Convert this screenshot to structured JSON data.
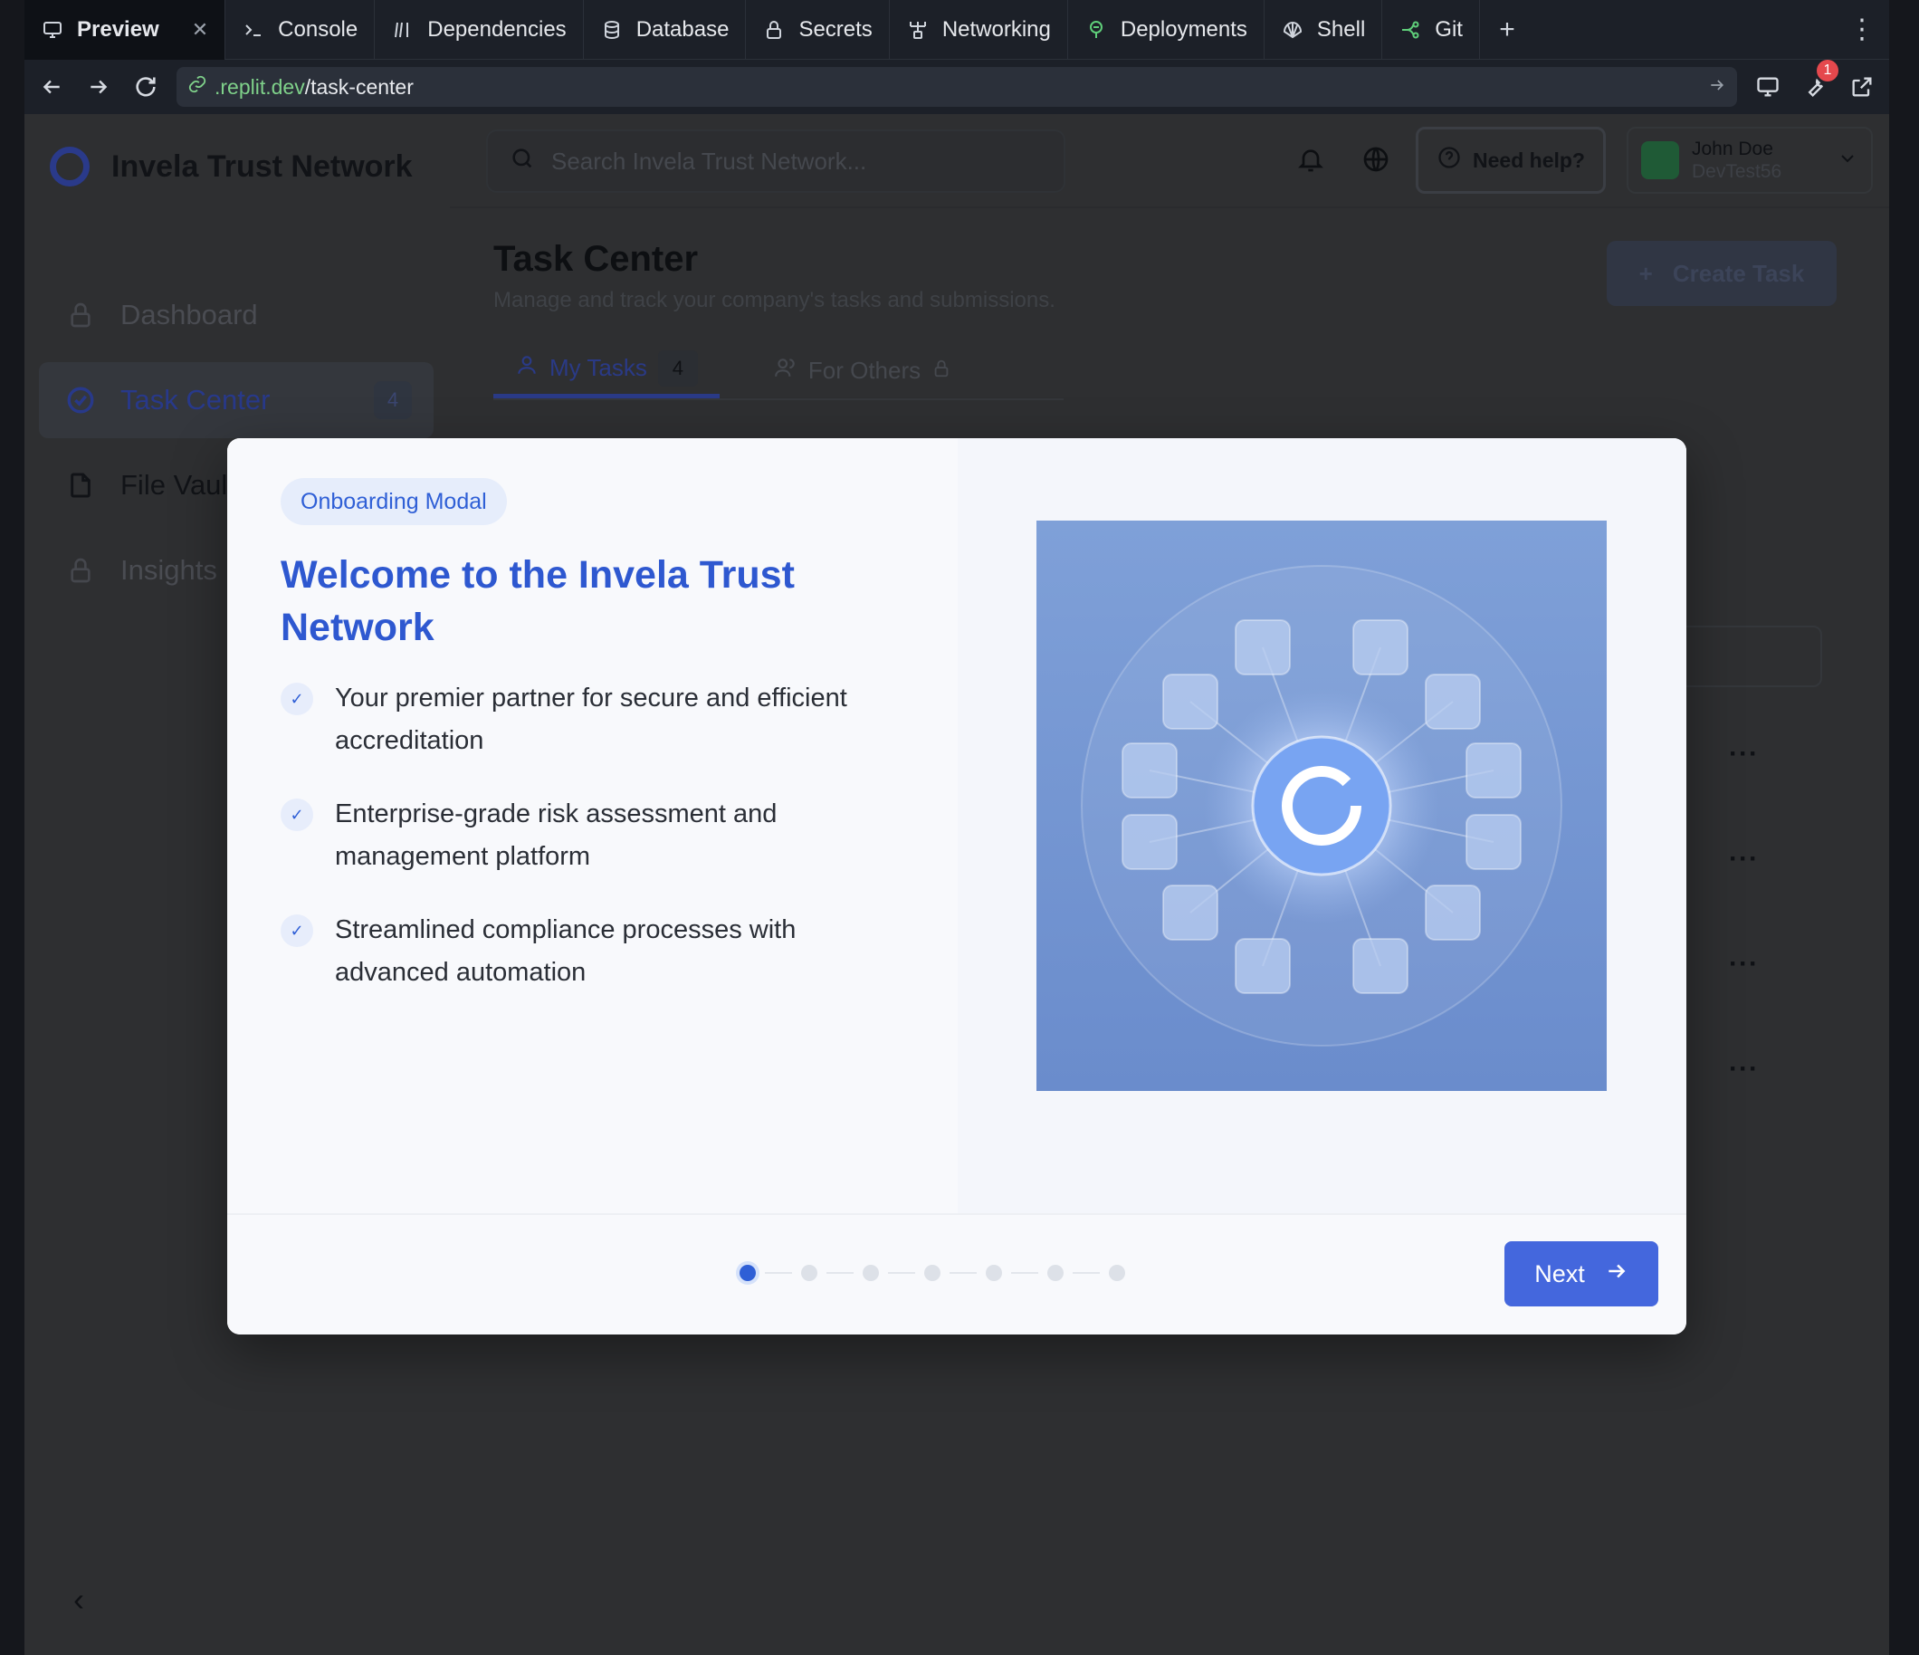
{
  "browser": {
    "tabs": [
      {
        "label": "Preview",
        "icon": "monitor-icon"
      },
      {
        "label": "Console",
        "icon": "terminal-icon"
      },
      {
        "label": "Dependencies",
        "icon": "package-icon"
      },
      {
        "label": "Database",
        "icon": "database-icon"
      },
      {
        "label": "Secrets",
        "icon": "lock-icon"
      },
      {
        "label": "Networking",
        "icon": "network-icon"
      },
      {
        "label": "Deployments",
        "icon": "rocket-icon"
      },
      {
        "label": "Shell",
        "icon": "shell-icon"
      },
      {
        "label": "Git",
        "icon": "git-branch-icon"
      }
    ],
    "url_domain": ".replit.dev",
    "url_path": "/task-center",
    "devtools_badge": "1"
  },
  "app": {
    "brand": "Invela Trust Network",
    "search_placeholder": "Search Invela Trust Network...",
    "help_label": "Need help?",
    "user_name": "John Doe",
    "user_company": "DevTest56",
    "nav": [
      {
        "label": "Dashboard",
        "icon": "lock-icon"
      },
      {
        "label": "Task Center",
        "icon": "check-circle-icon",
        "count": "4"
      },
      {
        "label": "File Vault",
        "icon": "file-icon"
      },
      {
        "label": "Insights",
        "icon": "lock-icon"
      }
    ],
    "page_title": "Task Center",
    "page_subtitle": "Manage and track your company's tasks and submissions.",
    "create_label": "Create Task",
    "tabs": [
      {
        "label": "My Tasks",
        "count": "4"
      },
      {
        "label": "For Others"
      }
    ]
  },
  "modal": {
    "pill": "Onboarding Modal",
    "title": "Welcome to the Invela Trust Network",
    "bullets": [
      "Your premier partner for secure and efficient accreditation",
      "Enterprise-grade risk assessment and management platform",
      "Streamlined compliance processes with advanced automation"
    ],
    "steps_total": 7,
    "current_step": 1,
    "next_label": "Next"
  },
  "colors": {
    "accent": "#2e58d0",
    "button": "#4467dd",
    "overlay": "#2e2f31"
  }
}
